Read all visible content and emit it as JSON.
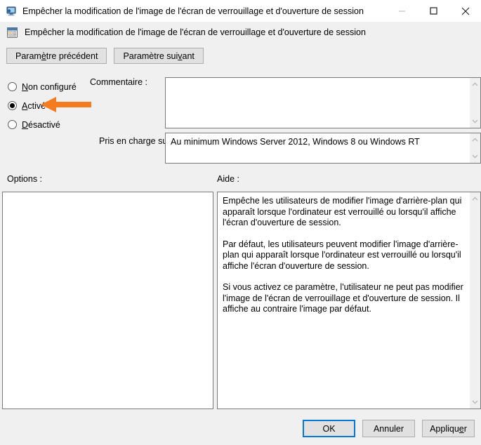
{
  "window": {
    "title": "Empêcher la modification de l'image de l'écran de verrouillage et d'ouverture de session",
    "icon": "monitor-icon",
    "controls": {
      "minimize": "minimize-icon",
      "maximize": "maximize-icon",
      "close": "close-icon"
    }
  },
  "header": {
    "icon": "policy-setting-icon",
    "title": "Empêcher la modification de l'image de l'écran de verrouillage et d'ouverture de session"
  },
  "toolbar": {
    "previous_setting": "Paramètre précédent",
    "next_setting": "Paramètre suivant"
  },
  "state_options": [
    {
      "label": "Non configuré",
      "mnemonic": "N",
      "selected": false
    },
    {
      "label": "Activé",
      "mnemonic": "A",
      "selected": true
    },
    {
      "label": "Désactivé",
      "mnemonic": "D",
      "selected": false
    }
  ],
  "fields": {
    "comment_label": "Commentaire :",
    "comment_value": "",
    "support_label": "Pris en charge sur :",
    "support_value": "Au minimum Windows Server 2012, Windows 8 ou Windows RT"
  },
  "panels": {
    "options_label": "Options :",
    "options_content": "",
    "help_label": "Aide :",
    "help_paragraphs": [
      "Empêche les utilisateurs de modifier l'image d'arrière-plan qui apparaît lorsque l'ordinateur est verrouillé ou lorsqu'il affiche l'écran d'ouverture de session.",
      "Par défaut, les utilisateurs peuvent modifier l'image d'arrière-plan qui apparaît lorsque l'ordinateur est verrouillé ou lorsqu'il affiche l'écran d'ouverture de session.",
      "Si vous activez ce paramètre, l'utilisateur ne peut pas modifier l'image de l'écran de verrouillage et d'ouverture de session. Il affiche au contraire l'image par défaut."
    ]
  },
  "footer": {
    "ok": "OK",
    "cancel": "Annuler",
    "apply": "Appliquer"
  },
  "annotation": {
    "type": "arrow-left",
    "color": "#f47b20",
    "points_to": "Activé"
  },
  "colors": {
    "accent": "#0078d7",
    "window_background": "#f0f0f0",
    "field_background": "#ffffff",
    "annotation_orange": "#f47b20"
  }
}
